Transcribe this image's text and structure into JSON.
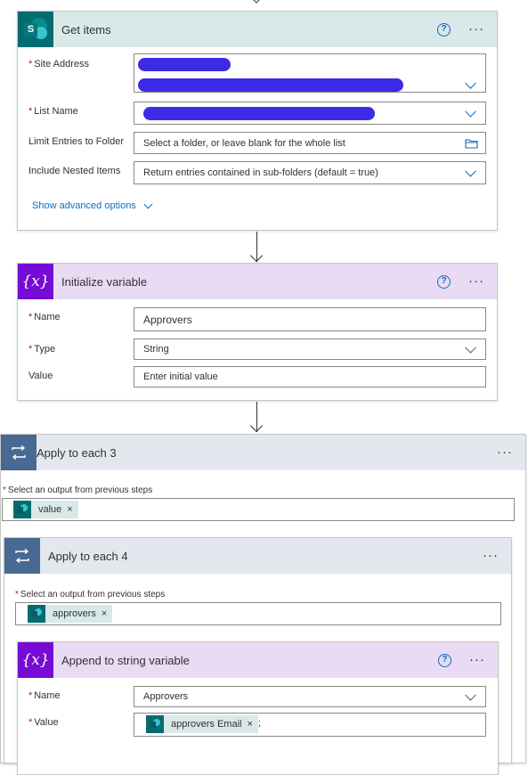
{
  "get_items": {
    "title": "Get items",
    "site_address_label": "Site Address",
    "list_name_label": "List Name",
    "limit_entries_label": "Limit Entries to Folder",
    "limit_entries_placeholder": "Select a folder, or leave blank for the whole list",
    "nested_items_label": "Include Nested Items",
    "nested_items_value": "Return entries contained in sub-folders (default = true)",
    "advanced_link": "Show advanced options"
  },
  "init_variable": {
    "title": "Initialize variable",
    "icon_text": "{x}",
    "name_label": "Name",
    "name_value": "Approvers",
    "type_label": "Type",
    "type_value": "String",
    "value_label": "Value",
    "value_placeholder": "Enter initial value"
  },
  "apply_each_3": {
    "title": "Apply to each 3",
    "select_label": "Select an output from previous steps",
    "token": "value",
    "token_close": "×"
  },
  "apply_each_4": {
    "title": "Apply to each 4",
    "select_label": "Select an output from previous steps",
    "token": "approvers",
    "token_close": "×"
  },
  "append_variable": {
    "title": "Append to string variable",
    "icon_text": "{x}",
    "name_label": "Name",
    "name_value": "Approvers",
    "value_label": "Value",
    "token": "approvers Email",
    "token_close": "×",
    "suffix": ";"
  },
  "common": {
    "help": "?",
    "more": "···",
    "required_mark": "*"
  },
  "colors": {
    "sharepoint_header": "#d9e8e9",
    "variable_header": "#e9dbf3",
    "loop_header": "#e3e8ef",
    "variable_tile": "#770bd6",
    "loop_tile": "#486991",
    "link": "#0f6cbd"
  }
}
